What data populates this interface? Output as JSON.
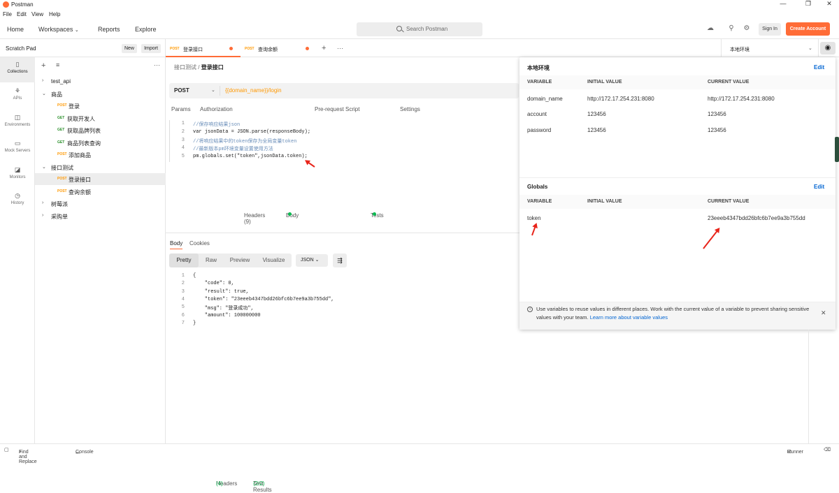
{
  "app": {
    "title": "Postman",
    "menu": [
      "File",
      "Edit",
      "View",
      "Help"
    ]
  },
  "header": {
    "nav": [
      "Home",
      "Workspaces",
      "Reports",
      "Explore"
    ],
    "search_placeholder": "Search Postman",
    "sign_in": "Sign In",
    "create_account": "Create Account"
  },
  "scratch": {
    "title": "Scratch Pad",
    "new": "New",
    "import": "Import"
  },
  "rail": [
    {
      "label": "Collections",
      "icon": "collections-icon"
    },
    {
      "label": "APIs",
      "icon": "apis-icon"
    },
    {
      "label": "Environments",
      "icon": "environments-icon"
    },
    {
      "label": "Mock Servers",
      "icon": "mock-servers-icon"
    },
    {
      "label": "Monitors",
      "icon": "monitors-icon"
    },
    {
      "label": "History",
      "icon": "history-icon"
    }
  ],
  "tree": [
    {
      "name": "test_api",
      "method": "",
      "level": 0,
      "chev": "›"
    },
    {
      "name": "商品",
      "method": "",
      "level": 0,
      "chev": "⌄"
    },
    {
      "name": "登录",
      "method": "POST",
      "level": 1
    },
    {
      "name": "获取开发人",
      "method": "GET",
      "level": 1
    },
    {
      "name": "获取品牌列表",
      "method": "GET",
      "level": 1
    },
    {
      "name": "商品列表查询",
      "method": "GET",
      "level": 1
    },
    {
      "name": "添加商品",
      "method": "POST",
      "level": 1
    },
    {
      "name": "接口测试",
      "method": "",
      "level": 0,
      "chev": "⌄"
    },
    {
      "name": "登录接口",
      "method": "POST",
      "level": 1,
      "selected": true
    },
    {
      "name": "查询余额",
      "method": "POST",
      "level": 1
    },
    {
      "name": "树莓派",
      "method": "",
      "level": 0,
      "chev": "›"
    },
    {
      "name": "采购单",
      "method": "",
      "level": 0,
      "chev": "›"
    }
  ],
  "tabs": [
    {
      "method": "POST",
      "name": "登录接口"
    },
    {
      "method": "POST",
      "name": "查询余额"
    }
  ],
  "environment": {
    "selected": "本地环境"
  },
  "request": {
    "breadcrumb_parent": "接口测试",
    "breadcrumb_sep": "/",
    "breadcrumb_current": "登录接口",
    "method": "POST",
    "url": "{{domain_name}}/login",
    "tabs": [
      "Params",
      "Authorization",
      "Headers (9)",
      "Body",
      "Pre-request Script",
      "Tests",
      "Settings"
    ],
    "active_tab": "Tests",
    "script": [
      "//保存响应结果json",
      "var jsonData = JSON.parse(responseBody);",
      "//将响应结果中的token保存为全局变量token",
      "//最新版本pm环境变量设置使用方法",
      "pm.globals.set(\"token\",jsonData.token);"
    ]
  },
  "response": {
    "tabs": [
      "Body",
      "Cookies",
      "Headers",
      "Test Results"
    ],
    "headers_count": "(4)",
    "test_results_count": "(2/2)",
    "views": [
      "Pretty",
      "Raw",
      "Preview",
      "Visualize"
    ],
    "format": "JSON",
    "body_lines": [
      "{",
      "    \"code\": 0,",
      "    \"result\": true,",
      "    \"token\": \"23eeeb4347bdd26bfc6b7ee9a3b755dd\",",
      "    \"msg\": \"登录成功\",",
      "    \"amount\": 100000000",
      "}"
    ]
  },
  "env_panel": {
    "env_title": "本地环境",
    "edit": "Edit",
    "columns": [
      "VARIABLE",
      "INITIAL VALUE",
      "CURRENT VALUE"
    ],
    "env_vars": [
      {
        "variable": "domain_name",
        "initial": "http://172.17.254.231:8080",
        "current": "http://172.17.254.231:8080"
      },
      {
        "variable": "account",
        "initial": "123456",
        "current": "123456"
      },
      {
        "variable": "password",
        "initial": "123456",
        "current": "123456"
      }
    ],
    "globals_title": "Globals",
    "globals": [
      {
        "variable": "token",
        "initial": "",
        "current": "23eeeb4347bdd26bfc6b7ee9a3b755dd"
      }
    ],
    "notice": "Use variables to reuse values in different places. Work with the current value of a variable to prevent sharing sensitive values with your team.",
    "notice_link": "Learn more about variable values"
  },
  "status": {
    "find": "Find and Replace",
    "console": "Console",
    "runner": "Runner"
  },
  "colors": {
    "accent": "#ff6c37",
    "post": "#ff9800",
    "get": "#2a8f2a",
    "link": "#0265d2",
    "annotation": "#e8241a"
  }
}
